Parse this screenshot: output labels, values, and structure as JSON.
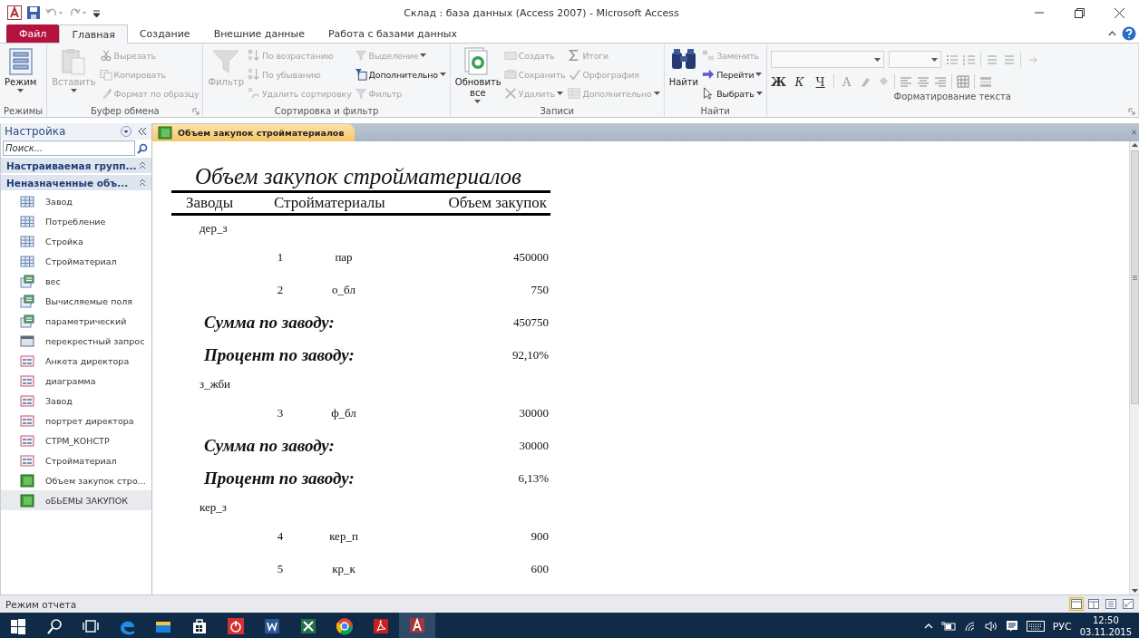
{
  "window": {
    "title": "Склад : база данных (Access 2007)  -  Microsoft Access"
  },
  "ribbon_tabs": [
    {
      "label": "Файл",
      "kind": "file",
      "selected": false
    },
    {
      "label": "Главная",
      "kind": "tab",
      "selected": true
    },
    {
      "label": "Создание",
      "kind": "tab",
      "selected": false
    },
    {
      "label": "Внешние данные",
      "kind": "tab",
      "selected": false
    },
    {
      "label": "Работа с базами данных",
      "kind": "tab",
      "selected": false
    }
  ],
  "ribbon_groups": [
    {
      "label": "Режимы",
      "kind": "commands",
      "launcher": false,
      "items": [
        {
          "label": "Режим",
          "kind": "large",
          "disabled": false,
          "menu": true
        }
      ]
    },
    {
      "label": "Буфер обмена",
      "kind": "commands",
      "launcher": true,
      "items": [
        {
          "label": "Вставить",
          "kind": "large",
          "disabled": true,
          "menu": true
        },
        {
          "label": "Вырезать",
          "kind": "small",
          "disabled": true,
          "menu": false
        },
        {
          "label": "Копировать",
          "kind": "small",
          "disabled": true,
          "menu": false
        },
        {
          "label": "Формат по образцу",
          "kind": "small",
          "disabled": true,
          "menu": false
        }
      ]
    },
    {
      "label": "Сортировка и фильтр",
      "kind": "commands",
      "launcher": false,
      "items": [
        {
          "label": "Фильтр",
          "kind": "large",
          "disabled": true,
          "menu": false
        },
        {
          "label": "По возрастанию",
          "kind": "small",
          "disabled": true,
          "menu": false
        },
        {
          "label": "По убыванию",
          "kind": "small",
          "disabled": true,
          "menu": false
        },
        {
          "label": "Удалить сортировку",
          "kind": "small",
          "disabled": true,
          "menu": false
        },
        {
          "label": "Выделение",
          "kind": "small",
          "disabled": true,
          "menu": true
        },
        {
          "label": "Дополнительно",
          "kind": "small",
          "disabled": false,
          "menu": true
        },
        {
          "label": "Фильтр",
          "kind": "small",
          "disabled": true,
          "menu": false
        }
      ]
    },
    {
      "label": "Записи",
      "kind": "commands",
      "launcher": false,
      "items": [
        {
          "label": "Обновить все",
          "kind": "large",
          "disabled": false,
          "menu": true
        },
        {
          "label": "Создать",
          "kind": "small",
          "disabled": true,
          "menu": false
        },
        {
          "label": "Сохранить",
          "kind": "small",
          "disabled": true,
          "menu": false
        },
        {
          "label": "Удалить",
          "kind": "small",
          "disabled": true,
          "menu": true
        },
        {
          "label": "Итоги",
          "kind": "small",
          "disabled": true,
          "menu": false
        },
        {
          "label": "Орфография",
          "kind": "small",
          "disabled": true,
          "menu": false
        },
        {
          "label": "Дополнительно",
          "kind": "small",
          "disabled": true,
          "menu": true
        }
      ]
    },
    {
      "label": "Найти",
      "kind": "commands",
      "launcher": false,
      "items": [
        {
          "label": "Найти",
          "kind": "large",
          "disabled": false,
          "menu": false
        },
        {
          "label": "Заменить",
          "kind": "small",
          "disabled": true,
          "menu": false
        },
        {
          "label": "Перейти",
          "kind": "small",
          "disabled": false,
          "menu": true
        },
        {
          "label": "Выбрать",
          "kind": "small",
          "disabled": false,
          "menu": true
        }
      ]
    },
    {
      "label": "Форматирование текста",
      "kind": "format",
      "launcher": true,
      "text_buttons": [
        {
          "label": "Ж",
          "disabled": false
        },
        {
          "label": "К",
          "disabled": false
        },
        {
          "label": "Ч",
          "disabled": false
        },
        {
          "label": "A",
          "disabled": true
        }
      ]
    }
  ],
  "nav": {
    "title": "Настройка",
    "search_placeholder": "Поиск...",
    "groups": [
      {
        "label": "Настраиваемая групп...",
        "expanded": true
      },
      {
        "label": "Неназначенные объ...",
        "expanded": true,
        "items": [
          {
            "label": "Завод",
            "kind": "table",
            "selected": false
          },
          {
            "label": "Потребление",
            "kind": "table",
            "selected": false
          },
          {
            "label": "Стройка",
            "kind": "table",
            "selected": false
          },
          {
            "label": "Стройматериал",
            "kind": "table",
            "selected": false
          },
          {
            "label": "вес",
            "kind": "query",
            "selected": false
          },
          {
            "label": "Вычисляемые поля",
            "kind": "query",
            "selected": false
          },
          {
            "label": "параметрический",
            "kind": "query",
            "selected": false
          },
          {
            "label": "перекрестный запрос",
            "kind": "crosstab",
            "selected": false
          },
          {
            "label": "Анкета директора",
            "kind": "form",
            "selected": false
          },
          {
            "label": "диаграмма",
            "kind": "form",
            "selected": false
          },
          {
            "label": "Завод",
            "kind": "form",
            "selected": false
          },
          {
            "label": "портрет директора",
            "kind": "form",
            "selected": false
          },
          {
            "label": "СТРМ_КОНСТР",
            "kind": "form",
            "selected": false
          },
          {
            "label": "Стройматериал",
            "kind": "form",
            "selected": false
          },
          {
            "label": "Объем закупок стро...",
            "kind": "report",
            "selected": false
          },
          {
            "label": "оБЬЕМЫ ЗАКУПОК",
            "kind": "report",
            "selected": true
          }
        ]
      }
    ]
  },
  "document_tabs": [
    {
      "label": "Объем закупок стройматериалов",
      "selected": true
    }
  ],
  "report": {
    "title": "Объем закупок стройматериалов",
    "columns": [
      "Заводы",
      "Стройматериалы",
      "Объем закупок"
    ],
    "groups": [
      {
        "name": "дер_з",
        "rows": [
          {
            "number": "1",
            "material": "пар",
            "volume": "450000"
          },
          {
            "number": "2",
            "material": "о_бл",
            "volume": "750"
          }
        ],
        "summary": {
          "sum_label": "Сумма по заводу:",
          "sum": "450750",
          "percent_label": "Процент по заводу:",
          "percent": "92,10%"
        }
      },
      {
        "name": "з_жби",
        "rows": [
          {
            "number": "3",
            "material": "ф_бл",
            "volume": "30000"
          }
        ],
        "summary": {
          "sum_label": "Сумма по заводу:",
          "sum": "30000",
          "percent_label": "Процент по заводу:",
          "percent": "6,13%"
        }
      },
      {
        "name": "кер_з",
        "rows": [
          {
            "number": "4",
            "material": "кер_п",
            "volume": "900"
          },
          {
            "number": "5",
            "material": "кр_к",
            "volume": "600"
          }
        ]
      }
    ]
  },
  "status_bar": {
    "text": "Режим отчета",
    "views": [
      {
        "selected": true
      },
      {
        "selected": false
      },
      {
        "selected": false
      },
      {
        "selected": false
      }
    ]
  },
  "taskbar": {
    "apps": [
      {
        "kind": "start",
        "active": false
      },
      {
        "kind": "search",
        "active": false
      },
      {
        "kind": "taskview",
        "active": false
      },
      {
        "kind": "edge",
        "active": false
      },
      {
        "kind": "explorer",
        "active": false
      },
      {
        "kind": "store",
        "active": false
      },
      {
        "kind": "power",
        "active": false
      },
      {
        "kind": "word",
        "active": false
      },
      {
        "kind": "excel",
        "active": false
      },
      {
        "kind": "chrome",
        "active": false
      },
      {
        "kind": "acrobat",
        "active": false
      },
      {
        "kind": "access",
        "active": true
      }
    ],
    "language": "РУС",
    "time": "12:50",
    "date": "03.11.2015"
  }
}
